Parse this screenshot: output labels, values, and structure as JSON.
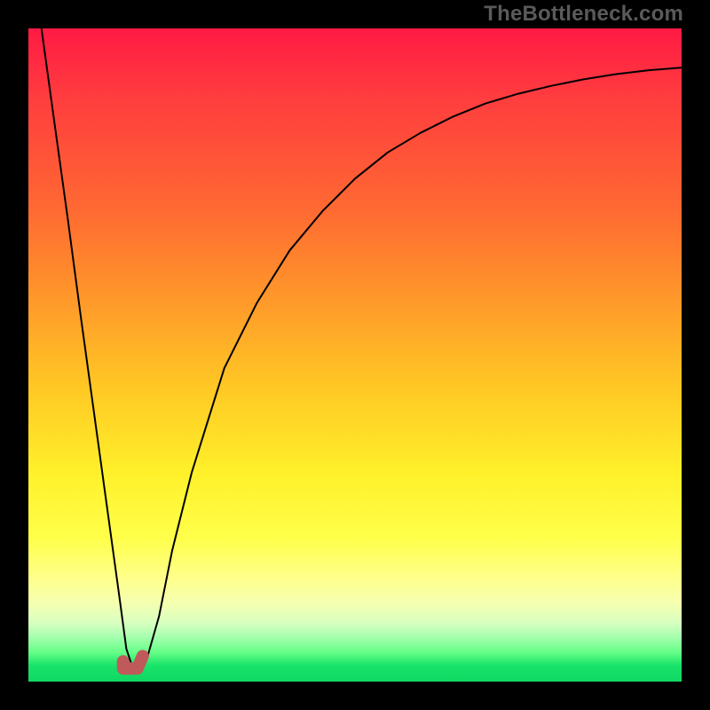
{
  "watermark": "TheBottleneck.com",
  "chart_data": {
    "type": "line",
    "title": "",
    "xlabel": "",
    "ylabel": "",
    "xlim": [
      0,
      100
    ],
    "ylim": [
      0,
      100
    ],
    "grid": false,
    "legend": false,
    "background_gradient": {
      "top_color": "#ff1a44",
      "bottom_color": "#0fd862",
      "description": "red-to-green vertical heat gradient"
    },
    "series": [
      {
        "name": "bottleneck-curve",
        "color": "#000000",
        "x": [
          2,
          4,
          6,
          8,
          10,
          12,
          14,
          15,
          16,
          17,
          18,
          20,
          22,
          25,
          30,
          35,
          40,
          45,
          50,
          55,
          60,
          65,
          70,
          75,
          80,
          85,
          90,
          95,
          100
        ],
        "y": [
          100,
          85.5,
          71,
          56,
          41.5,
          27,
          12.5,
          5,
          2,
          2,
          3,
          10,
          20,
          32,
          48,
          58,
          66,
          72,
          77,
          81,
          84,
          86.5,
          88.5,
          90,
          91.2,
          92.2,
          93,
          93.6,
          94
        ]
      },
      {
        "name": "optimal-marker",
        "color": "#c05a5a",
        "type": "marker-segment",
        "x": [
          14.5,
          17.5
        ],
        "y": [
          2,
          2
        ]
      }
    ],
    "optimal_x": 16
  }
}
